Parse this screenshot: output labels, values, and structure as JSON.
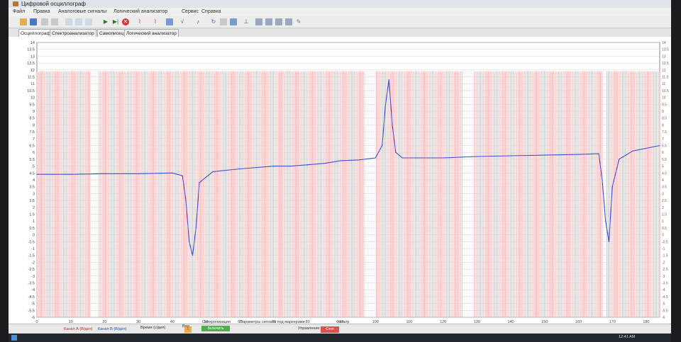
{
  "window": {
    "title": "Цифровой осциллограф"
  },
  "menu": [
    "Файл",
    "Правка",
    "Аналоговые сигналы",
    "Логический анализатор",
    "Сервис",
    "Справка"
  ],
  "tabs": [
    "Осциллограф",
    "Спектроанализатор",
    "Самописец",
    "Логический анализатор"
  ],
  "chart_data": {
    "type": "line",
    "y_left_ticks": [
      "14",
      "13.5",
      "13",
      "12.5",
      "12",
      "11.5",
      "11",
      "10.5",
      "10",
      "9.5",
      "9",
      "8.5",
      "8",
      "7.5",
      "7",
      "6.5",
      "6",
      "5.5",
      "5",
      "4.5",
      "4",
      "3.5",
      "3",
      "2.5",
      "2",
      "1.5",
      "1",
      "0.5",
      "0",
      "-0.5",
      "-1",
      "-1.5",
      "-2",
      "-2.5",
      "-3",
      "-3.5",
      "-4",
      "-4.5",
      "-5",
      "-5.5",
      "-6"
    ],
    "ylim": [
      -6,
      14
    ],
    "x_ticks": [
      "0",
      "10",
      "20",
      "30",
      "40",
      "50",
      "60",
      "70",
      "80",
      "90",
      "100",
      "110",
      "120",
      "130",
      "140",
      "150",
      "160",
      "170",
      "180"
    ],
    "xlim": [
      0,
      184
    ],
    "series": [
      {
        "color": "#3b4fd6",
        "x": [
          0,
          10,
          20,
          30,
          40,
          43,
          44,
          45,
          46,
          47,
          48,
          52,
          60,
          70,
          75,
          80,
          85,
          90,
          95,
          100,
          102,
          103,
          104,
          105,
          106,
          108,
          112,
          120,
          130,
          140,
          150,
          160,
          166,
          167,
          168,
          169,
          170,
          172,
          176,
          184
        ],
        "y": [
          4.4,
          4.4,
          4.45,
          4.45,
          4.5,
          4.3,
          2.5,
          -0.5,
          -1.5,
          0.5,
          3.8,
          4.6,
          4.8,
          5.0,
          5.0,
          5.1,
          5.2,
          5.4,
          5.45,
          5.6,
          6.5,
          9.5,
          11.3,
          8.0,
          6.0,
          5.6,
          5.6,
          5.6,
          5.7,
          5.75,
          5.8,
          5.85,
          5.9,
          4.0,
          1.0,
          -0.5,
          3.5,
          5.5,
          6.1,
          6.5
        ]
      }
    ],
    "grid": true
  },
  "bottom": {
    "ch_a": "Канал А (В/дел)",
    "ch_b": "Канал В (В/дел)",
    "time": "Время (с/дел)",
    "view": "Вид",
    "sync": "Синхронизация",
    "sync_btn": "Включить",
    "params": "Параметры сигнала под маркерами",
    "filter": "Фильтр",
    "control": "Управление",
    "stop": "Стоп"
  },
  "taskbar": {
    "clock": "12:41 AM"
  }
}
